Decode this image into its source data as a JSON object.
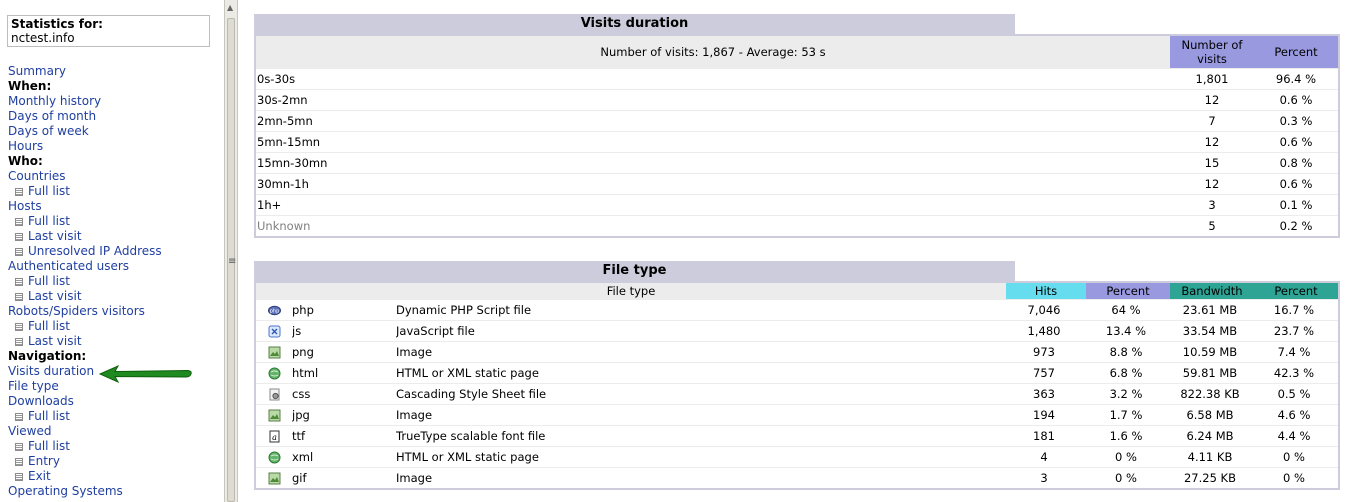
{
  "sidebar": {
    "stats_label": "Statistics for:",
    "site": "nctest.info",
    "items": [
      {
        "type": "link",
        "label": "Summary"
      },
      {
        "type": "head",
        "label": "When:"
      },
      {
        "type": "link",
        "label": "Monthly history"
      },
      {
        "type": "link",
        "label": "Days of month"
      },
      {
        "type": "link",
        "label": "Days of week"
      },
      {
        "type": "link",
        "label": "Hours"
      },
      {
        "type": "head",
        "label": "Who:"
      },
      {
        "type": "link",
        "label": "Countries"
      },
      {
        "type": "sub",
        "label": "Full list"
      },
      {
        "type": "link",
        "label": "Hosts"
      },
      {
        "type": "sub",
        "label": "Full list"
      },
      {
        "type": "sub",
        "label": "Last visit"
      },
      {
        "type": "sub",
        "label": "Unresolved IP Address"
      },
      {
        "type": "link",
        "label": "Authenticated users"
      },
      {
        "type": "sub",
        "label": "Full list"
      },
      {
        "type": "sub",
        "label": "Last visit"
      },
      {
        "type": "link",
        "label": "Robots/Spiders visitors"
      },
      {
        "type": "sub",
        "label": "Full list"
      },
      {
        "type": "sub",
        "label": "Last visit"
      },
      {
        "type": "head",
        "label": "Navigation:"
      },
      {
        "type": "link",
        "label": "Visits duration"
      },
      {
        "type": "link",
        "label": "File type"
      },
      {
        "type": "link",
        "label": "Downloads"
      },
      {
        "type": "sub",
        "label": "Full list"
      },
      {
        "type": "link",
        "label": "Viewed"
      },
      {
        "type": "sub",
        "label": "Full list"
      },
      {
        "type": "sub",
        "label": "Entry"
      },
      {
        "type": "sub",
        "label": "Exit"
      },
      {
        "type": "link",
        "label": "Operating Systems"
      }
    ]
  },
  "visits_duration": {
    "title": "Visits duration",
    "summary": "Number of visits: 1,867 - Average: 53 s",
    "col_visits": "Number of visits",
    "col_percent": "Percent",
    "rows": [
      {
        "label": "0s-30s",
        "visits": "1,801",
        "percent": "96.4 %"
      },
      {
        "label": "30s-2mn",
        "visits": "12",
        "percent": "0.6 %"
      },
      {
        "label": "2mn-5mn",
        "visits": "7",
        "percent": "0.3 %"
      },
      {
        "label": "5mn-15mn",
        "visits": "12",
        "percent": "0.6 %"
      },
      {
        "label": "15mn-30mn",
        "visits": "15",
        "percent": "0.8 %"
      },
      {
        "label": "30mn-1h",
        "visits": "12",
        "percent": "0.6 %"
      },
      {
        "label": "1h+",
        "visits": "3",
        "percent": "0.1 %"
      },
      {
        "label": "Unknown",
        "visits": "5",
        "percent": "0.2 %",
        "muted": true
      }
    ]
  },
  "file_type": {
    "title": "File type",
    "col_type": "File type",
    "col_hits": "Hits",
    "col_percent": "Percent",
    "col_bandwidth": "Bandwidth",
    "col_bw_percent": "Percent",
    "colors": {
      "hits": "#66ddee",
      "percent": "#9999e0",
      "bandwidth": "#2ea495"
    },
    "rows": [
      {
        "icon": "php-icon",
        "ext": "php",
        "desc": "Dynamic PHP Script file",
        "hits": "7,046",
        "percent": "64 %",
        "bandwidth": "23.61 MB",
        "bw_percent": "16.7 %"
      },
      {
        "icon": "js-icon",
        "ext": "js",
        "desc": "JavaScript file",
        "hits": "1,480",
        "percent": "13.4 %",
        "bandwidth": "33.54 MB",
        "bw_percent": "23.7 %"
      },
      {
        "icon": "image-icon",
        "ext": "png",
        "desc": "Image",
        "hits": "973",
        "percent": "8.8 %",
        "bandwidth": "10.59 MB",
        "bw_percent": "7.4 %"
      },
      {
        "icon": "html-icon",
        "ext": "html",
        "desc": "HTML or XML static page",
        "hits": "757",
        "percent": "6.8 %",
        "bandwidth": "59.81 MB",
        "bw_percent": "42.3 %"
      },
      {
        "icon": "css-icon",
        "ext": "css",
        "desc": "Cascading Style Sheet file",
        "hits": "363",
        "percent": "3.2 %",
        "bandwidth": "822.38 KB",
        "bw_percent": "0.5 %"
      },
      {
        "icon": "image-icon",
        "ext": "jpg",
        "desc": "Image",
        "hits": "194",
        "percent": "1.7 %",
        "bandwidth": "6.58 MB",
        "bw_percent": "4.6 %"
      },
      {
        "icon": "font-icon",
        "ext": "ttf",
        "desc": "TrueType scalable font file",
        "hits": "181",
        "percent": "1.6 %",
        "bandwidth": "6.24 MB",
        "bw_percent": "4.4 %"
      },
      {
        "icon": "html-icon",
        "ext": "xml",
        "desc": "HTML or XML static page",
        "hits": "4",
        "percent": "0 %",
        "bandwidth": "4.11 KB",
        "bw_percent": "0 %"
      },
      {
        "icon": "image-icon",
        "ext": "gif",
        "desc": "Image",
        "hits": "3",
        "percent": "0 %",
        "bandwidth": "27.25 KB",
        "bw_percent": "0 %"
      }
    ]
  }
}
